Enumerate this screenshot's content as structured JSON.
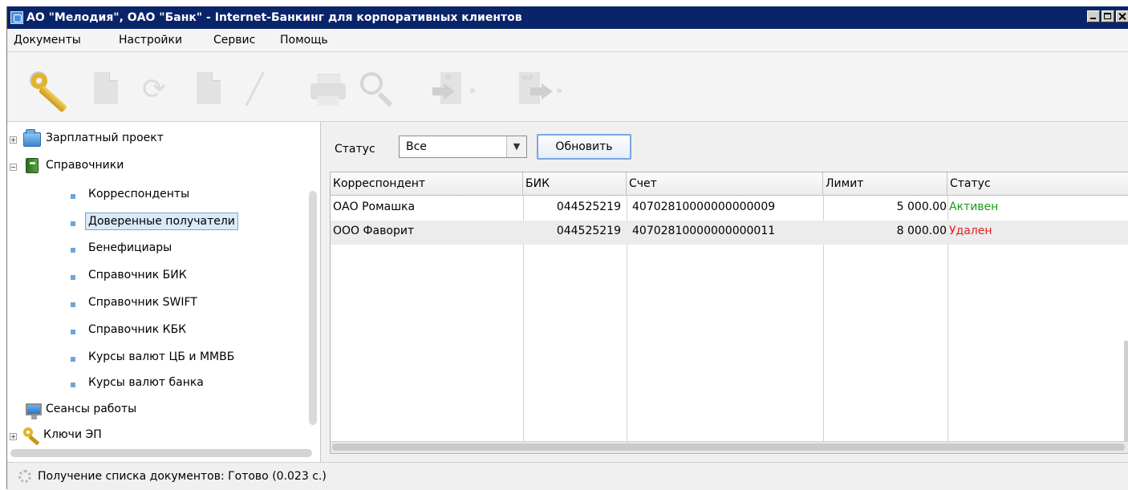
{
  "window": {
    "title": "АО \"Мелодия\", ОАО \"Банк\" - Internet-Банкинг для корпоративных клиентов"
  },
  "menu": [
    "Документы",
    "Настройки",
    "Сервис",
    "Помощь"
  ],
  "toolbar": {
    "icons": [
      "key-icon",
      "new-document-icon",
      "refresh-icon",
      "delete-document-icon",
      "edit-icon",
      "print-icon",
      "search-icon",
      "import-icon",
      "export-icon"
    ],
    "import_label": "in",
    "export_label": "out",
    "chevron": "»"
  },
  "sidebar": {
    "items": [
      {
        "label": "Зарплатный проект",
        "level": 0,
        "expander": "+",
        "icon": "folder-icon"
      },
      {
        "label": "Справочники",
        "level": 0,
        "expander": "-",
        "icon": "book-icon"
      },
      {
        "label": "Корреспонденты",
        "level": 1
      },
      {
        "label": "Доверенные получатели",
        "level": 1,
        "selected": true
      },
      {
        "label": "Бенефициары",
        "level": 1
      },
      {
        "label": "Справочник БИК",
        "level": 1
      },
      {
        "label": "Справочник SWIFT",
        "level": 1
      },
      {
        "label": "Справочник КБК",
        "level": 1
      },
      {
        "label": "Курсы валют ЦБ и ММВБ",
        "level": 1
      },
      {
        "label": "Курсы валют банка",
        "level": 1
      },
      {
        "label": "Сеансы работы",
        "level": 0,
        "icon": "monitor-icon"
      },
      {
        "label": "Ключи ЭП",
        "level": 0,
        "expander": "+",
        "icon": "keys-icon"
      }
    ]
  },
  "filter": {
    "label": "Статус",
    "value": "Все",
    "refresh_label": "Обновить",
    "dropdown_arrow": "▼"
  },
  "table": {
    "columns": [
      "Корреспондент",
      "БИК",
      "Счет",
      "Лимит",
      "Статус"
    ],
    "rows": [
      {
        "name": "ОАО Ромашка",
        "bik": "044525219",
        "account": "40702810000000000009",
        "limit": "5 000.00",
        "status": "Активен",
        "status_color": "#1a9a1a"
      },
      {
        "name": "ООО Фаворит",
        "bik": "044525219",
        "account": "40702810000000000011",
        "limit": "8 000.00",
        "status": "Удален",
        "status_color": "#e02020"
      }
    ]
  },
  "statusbar": {
    "text": "Получение списка документов: Готово (0.023 с.)"
  }
}
